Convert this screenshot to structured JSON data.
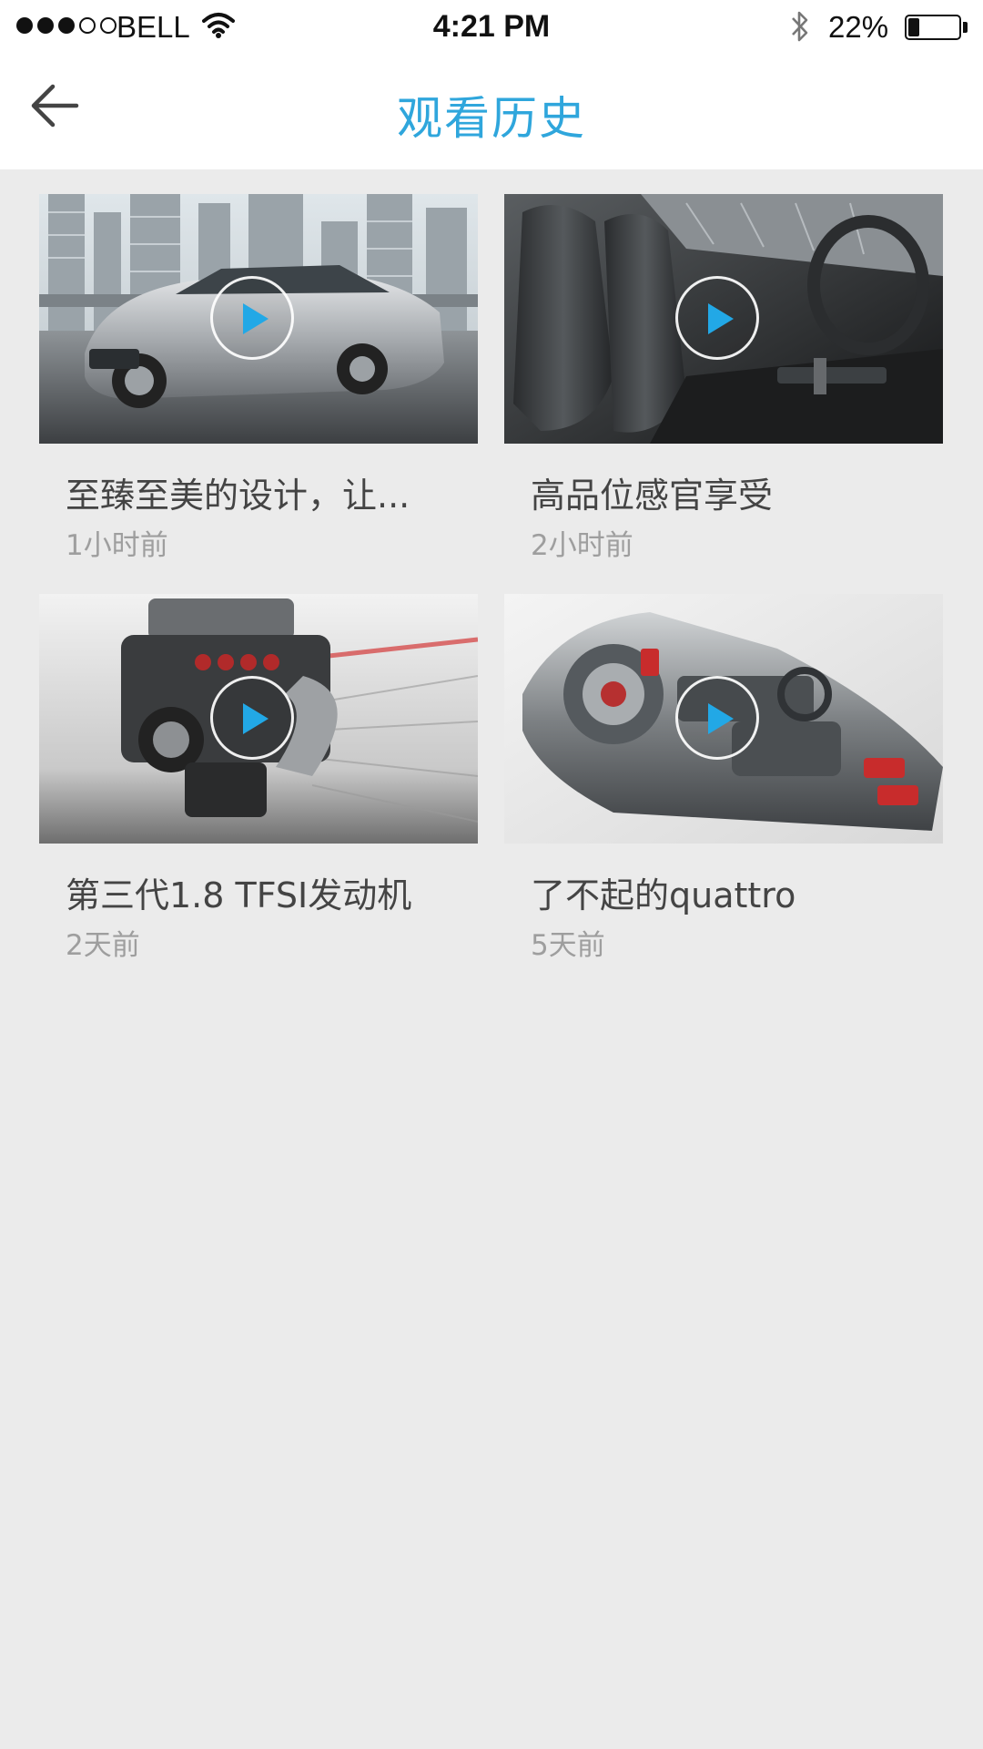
{
  "status_bar": {
    "carrier": "BELL",
    "time": "4:21 PM",
    "battery_percent_text": "22%",
    "battery_level": 0.22,
    "signal_bars_filled": 3,
    "signal_bars_total": 5
  },
  "nav": {
    "title": "观看历史",
    "title_color": "#2fa6dc"
  },
  "history": [
    {
      "title": "至臻至美的设计，让...",
      "time": "1小时前",
      "thumbnail": "silver-sedan-city"
    },
    {
      "title": "高品位感官享受",
      "time": "2小时前",
      "thumbnail": "car-interior-seats"
    },
    {
      "title": "第三代1.8 TFSI发动机",
      "time": "2天前",
      "thumbnail": "engine"
    },
    {
      "title": "了不起的quattro",
      "time": "5天前",
      "thumbnail": "transmission-cutaway"
    }
  ],
  "icons": {
    "back": "arrow-left-icon",
    "play": "play-icon",
    "wifi": "wifi-icon",
    "bluetooth": "bluetooth-icon",
    "battery": "battery-icon"
  },
  "colors": {
    "accent": "#2fa6dc",
    "background": "#ebebeb"
  }
}
